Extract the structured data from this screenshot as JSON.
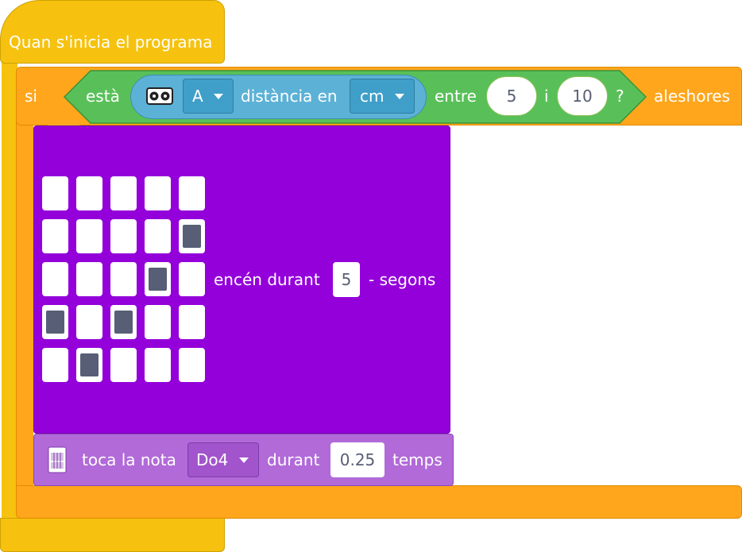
{
  "hat": {
    "label": "Quan s'inicia el programa"
  },
  "if_block": {
    "if_label": "si",
    "then_label": "aleshores",
    "condition": {
      "is_label": "està",
      "sensor": {
        "icon": "distance-sensor-icon",
        "port_value": "A",
        "measure_label": "distància en",
        "unit_value": "cm"
      },
      "between_label": "entre",
      "low_value": "5",
      "and_label": "i",
      "high_value": "10",
      "question_mark": "?"
    }
  },
  "led_block": {
    "label_prefix": "encén durant",
    "duration_value": "5",
    "label_suffix": "- segons",
    "matrix": [
      [
        0,
        0,
        0,
        0,
        0
      ],
      [
        0,
        0,
        0,
        0,
        1
      ],
      [
        0,
        0,
        0,
        1,
        0
      ],
      [
        1,
        0,
        1,
        0,
        0
      ],
      [
        0,
        1,
        0,
        0,
        0
      ]
    ]
  },
  "music_block": {
    "icon": "keyboard-icon",
    "label": "toca la nota",
    "note_value": "Do4",
    "during_label": "durant",
    "beats_value": "0.25",
    "beats_label": "temps"
  },
  "colors": {
    "event": "#f6c20f",
    "control": "#ffa61c",
    "operator": "#59c059",
    "sensing": "#5cb1d6",
    "display": "#9400da",
    "music": "#b16ad8"
  }
}
